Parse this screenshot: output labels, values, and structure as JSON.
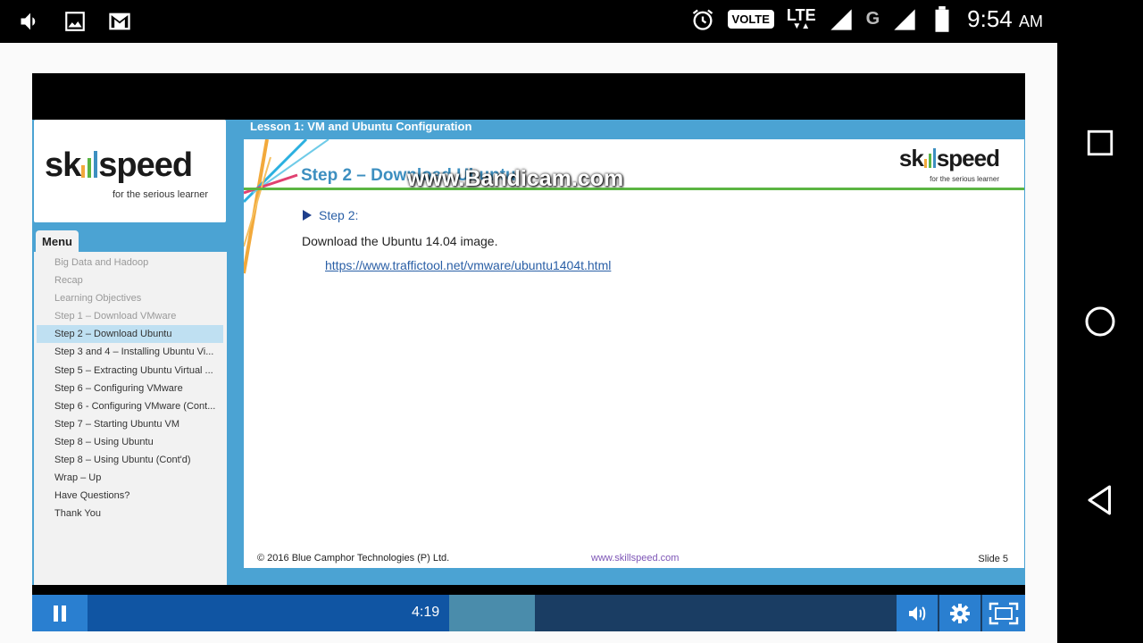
{
  "status_bar": {
    "volte": "VOLTE",
    "lte": "LTE",
    "network_g": "G",
    "time": "9:54",
    "ampm": "AM"
  },
  "course": {
    "logo_tagline": "for the serious learner",
    "menu_tab": "Menu",
    "menu_items": [
      {
        "label": "Big Data and Hadoop",
        "state": "visited"
      },
      {
        "label": "Recap",
        "state": "visited"
      },
      {
        "label": "Learning Objectives",
        "state": "visited"
      },
      {
        "label": "Step 1 – Download VMware",
        "state": "visited"
      },
      {
        "label": "Step 2 – Download Ubuntu",
        "state": "active"
      },
      {
        "label": "Step 3 and 4 – Installing Ubuntu Vi...",
        "state": "normal"
      },
      {
        "label": "Step 5 – Extracting Ubuntu Virtual ...",
        "state": "normal"
      },
      {
        "label": "Step 6 – Configuring VMware",
        "state": "normal"
      },
      {
        "label": "Step 6 - Configuring VMware (Cont...",
        "state": "normal"
      },
      {
        "label": "Step 7 – Starting Ubuntu VM",
        "state": "normal"
      },
      {
        "label": "Step 8 – Using Ubuntu",
        "state": "normal"
      },
      {
        "label": "Step 8 – Using Ubuntu (Cont'd)",
        "state": "normal"
      },
      {
        "label": "Wrap – Up",
        "state": "normal"
      },
      {
        "label": "Have Questions?",
        "state": "normal"
      },
      {
        "label": "Thank You",
        "state": "normal"
      }
    ],
    "lesson_title": "Lesson 1: VM and Ubuntu Configuration",
    "slide": {
      "title": "Step 2 – Download Ubuntu",
      "bullet": "Step 2:",
      "body": "Download the Ubuntu 14.04 image.",
      "link": "https://www.traffictool.net/vmware/ubuntu1404t.html",
      "logo_tagline": "for the serious learner",
      "copyright": "© 2016 Blue Camphor Technologies (P) Ltd.",
      "website": "www.skillspeed.com",
      "slide_number": "Slide 5"
    }
  },
  "watermark": "www.Bandicam.com",
  "player": {
    "time": "4:19",
    "progress_fraction": 0.46
  },
  "colors": {
    "course_blue": "#4ba3d3",
    "title_blue": "#3d8fc0",
    "green_line": "#5bb543",
    "control_blue": "#2a7fd0"
  }
}
